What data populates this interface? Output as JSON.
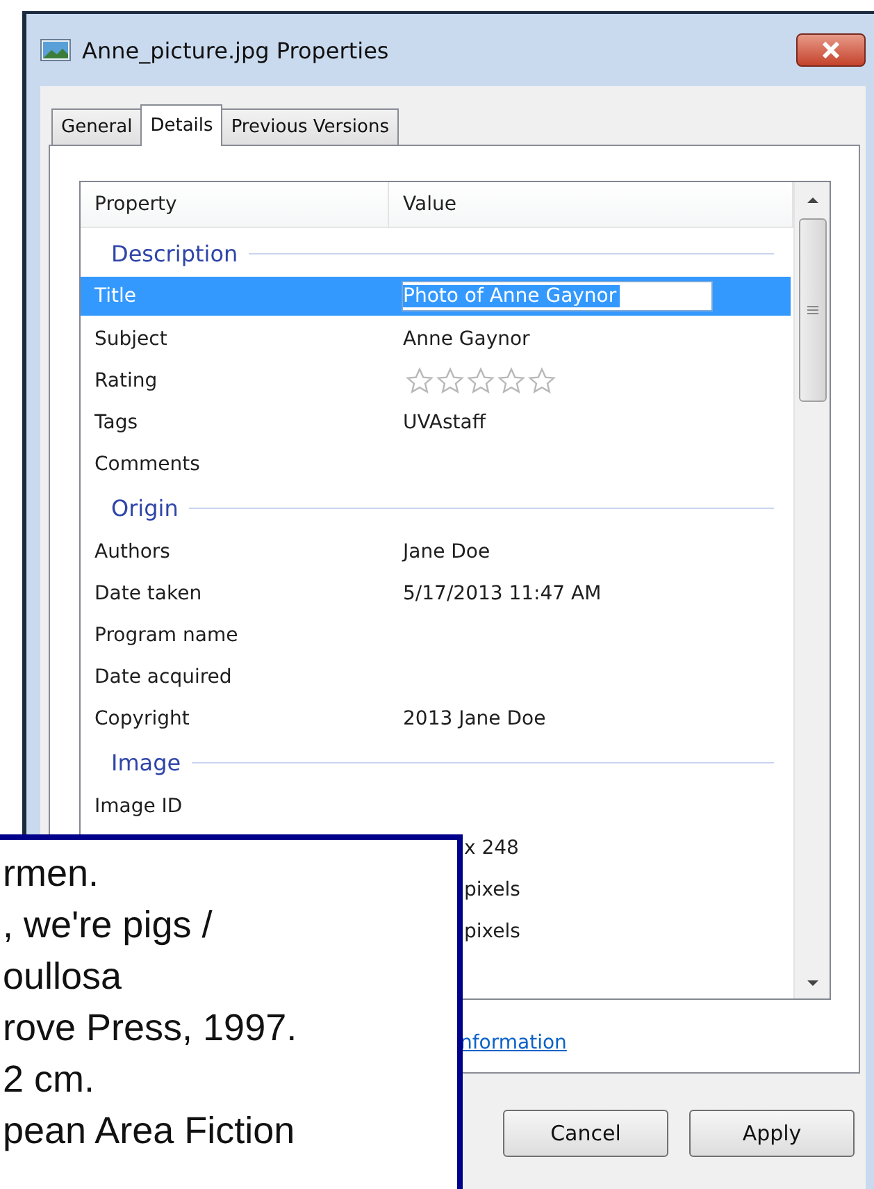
{
  "window": {
    "title": "Anne_picture.jpg Properties"
  },
  "tabs": [
    {
      "label": "General",
      "selected": false
    },
    {
      "label": "Details",
      "selected": true
    },
    {
      "label": "Previous Versions",
      "selected": false
    }
  ],
  "list": {
    "columns": [
      "Property",
      "Value"
    ],
    "rows": [
      {
        "kind": "group",
        "label": "Description"
      },
      {
        "kind": "field",
        "property": "Title",
        "value": "Photo of Anne Gaynor",
        "selected": true
      },
      {
        "kind": "field",
        "property": "Subject",
        "value": "Anne Gaynor",
        "selected": false
      },
      {
        "kind": "rating",
        "property": "Rating",
        "stars": 0
      },
      {
        "kind": "field",
        "property": "Tags",
        "value": "UVAstaff",
        "selected": false
      },
      {
        "kind": "field",
        "property": "Comments",
        "selected": false
      },
      {
        "kind": "group",
        "label": "Origin"
      },
      {
        "kind": "field",
        "property": "Authors",
        "value": "Jane Doe",
        "selected": false
      },
      {
        "kind": "field",
        "property": "Date taken",
        "value": "5/17/2013 11:47 AM",
        "selected": false
      },
      {
        "kind": "field",
        "property": "Program name",
        "selected": false
      },
      {
        "kind": "field",
        "property": "Date acquired",
        "selected": false
      },
      {
        "kind": "field",
        "property": "Copyright",
        "value": "2013 Jane Doe",
        "selected": false
      },
      {
        "kind": "group",
        "label": "Image"
      },
      {
        "kind": "field",
        "property": "Image ID",
        "selected": false
      },
      {
        "kind": "covered",
        "value": "x 248"
      },
      {
        "kind": "covered",
        "value": "pixels"
      },
      {
        "kind": "covered",
        "value": "pixels"
      }
    ]
  },
  "link": "nformation",
  "buttons": [
    "Cancel",
    "Apply"
  ],
  "overlay": {
    "lines": [
      "rmen.",
      ", we're pigs /",
      "oullosa",
      "rove Press, 1997.",
      "2 cm.",
      "pean Area Fiction"
    ]
  }
}
